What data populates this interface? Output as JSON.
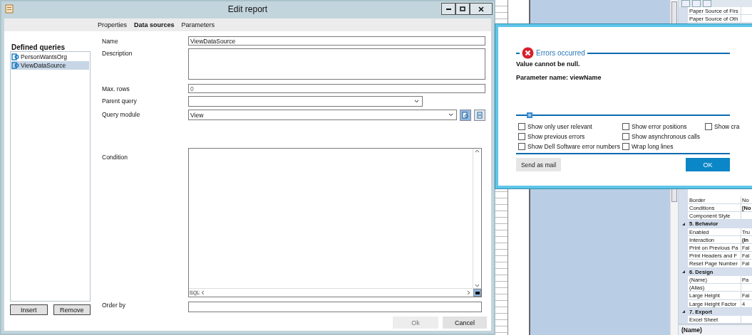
{
  "edit_report": {
    "title": "Edit report",
    "tabs": [
      {
        "label": "Properties",
        "selected": false
      },
      {
        "label": "Data sources",
        "selected": true
      },
      {
        "label": "Parameters",
        "selected": false
      }
    ],
    "queries_heading": "Defined queries",
    "queries": [
      {
        "label": "PersonWantsOrg",
        "selected": false
      },
      {
        "label": "ViewDataSource",
        "selected": true
      }
    ],
    "insert_button": "Insert",
    "remove_button": "Remove",
    "name": {
      "label": "Name",
      "value": "ViewDataSource"
    },
    "description": {
      "label": "Description"
    },
    "max_rows": {
      "label": "Max. rows",
      "value": "0"
    },
    "parent_query": {
      "label": "Parent query"
    },
    "query_module": {
      "label": "Query module",
      "value": "View"
    },
    "condition": {
      "label": "Condition",
      "sql_tag": "SQL"
    },
    "order_by": {
      "label": "Order by"
    },
    "ok_button": {
      "label": "Ok",
      "disabled": true
    },
    "cancel_button": {
      "label": "Cancel",
      "disabled": false
    }
  },
  "error_dialog": {
    "heading": "Errors occurred",
    "message": "Value cannot be null.",
    "parameter": "Parameter name: viewName",
    "options": [
      {
        "label": "Show only user relevant",
        "checked": false
      },
      {
        "label": "Show previous errors",
        "checked": false
      },
      {
        "label": "Show Dell Software error numbers",
        "checked": false
      },
      {
        "label": "Show error positions",
        "checked": false
      },
      {
        "label": "Show asynchronous calls",
        "checked": false
      },
      {
        "label": "Wrap long lines",
        "checked": false
      },
      {
        "label": "Show cra",
        "checked": false
      }
    ],
    "send_button": "Send as mail",
    "ok_button": "OK"
  },
  "property_grid": {
    "top_rows": [
      {
        "name": "Paper Source of Firs"
      },
      {
        "name": "Paper Source of Oth"
      }
    ],
    "rows": [
      {
        "kind": "property",
        "name": "Border",
        "value": "No"
      },
      {
        "kind": "property",
        "name": "Conditions",
        "value": "[No"
      },
      {
        "kind": "property",
        "name": "Component Style",
        "value": ""
      },
      {
        "kind": "category",
        "name": "5. Behavior",
        "expanded": true
      },
      {
        "kind": "property",
        "name": "Enabled",
        "value": "Tru"
      },
      {
        "kind": "property",
        "name": "Interaction",
        "value": "(In"
      },
      {
        "kind": "property",
        "name": "Print on Previous Pa",
        "value": "Fal"
      },
      {
        "kind": "property",
        "name": "Print Headers and F",
        "value": "Fal"
      },
      {
        "kind": "property",
        "name": "Reset Page Number",
        "value": "Fal"
      },
      {
        "kind": "category",
        "name": "6. Design",
        "expanded": true
      },
      {
        "kind": "property",
        "name": "(Name)",
        "value": "Pa"
      },
      {
        "kind": "property",
        "name": "(Alias)",
        "value": ""
      },
      {
        "kind": "property",
        "name": "Large Height",
        "value": "Fal"
      },
      {
        "kind": "property",
        "name": "Large Height Factor",
        "value": "4"
      },
      {
        "kind": "category",
        "name": "7. Export",
        "expanded": true
      },
      {
        "kind": "property",
        "name": "Excel Sheet",
        "value": ""
      }
    ],
    "footer": "(Name)"
  }
}
